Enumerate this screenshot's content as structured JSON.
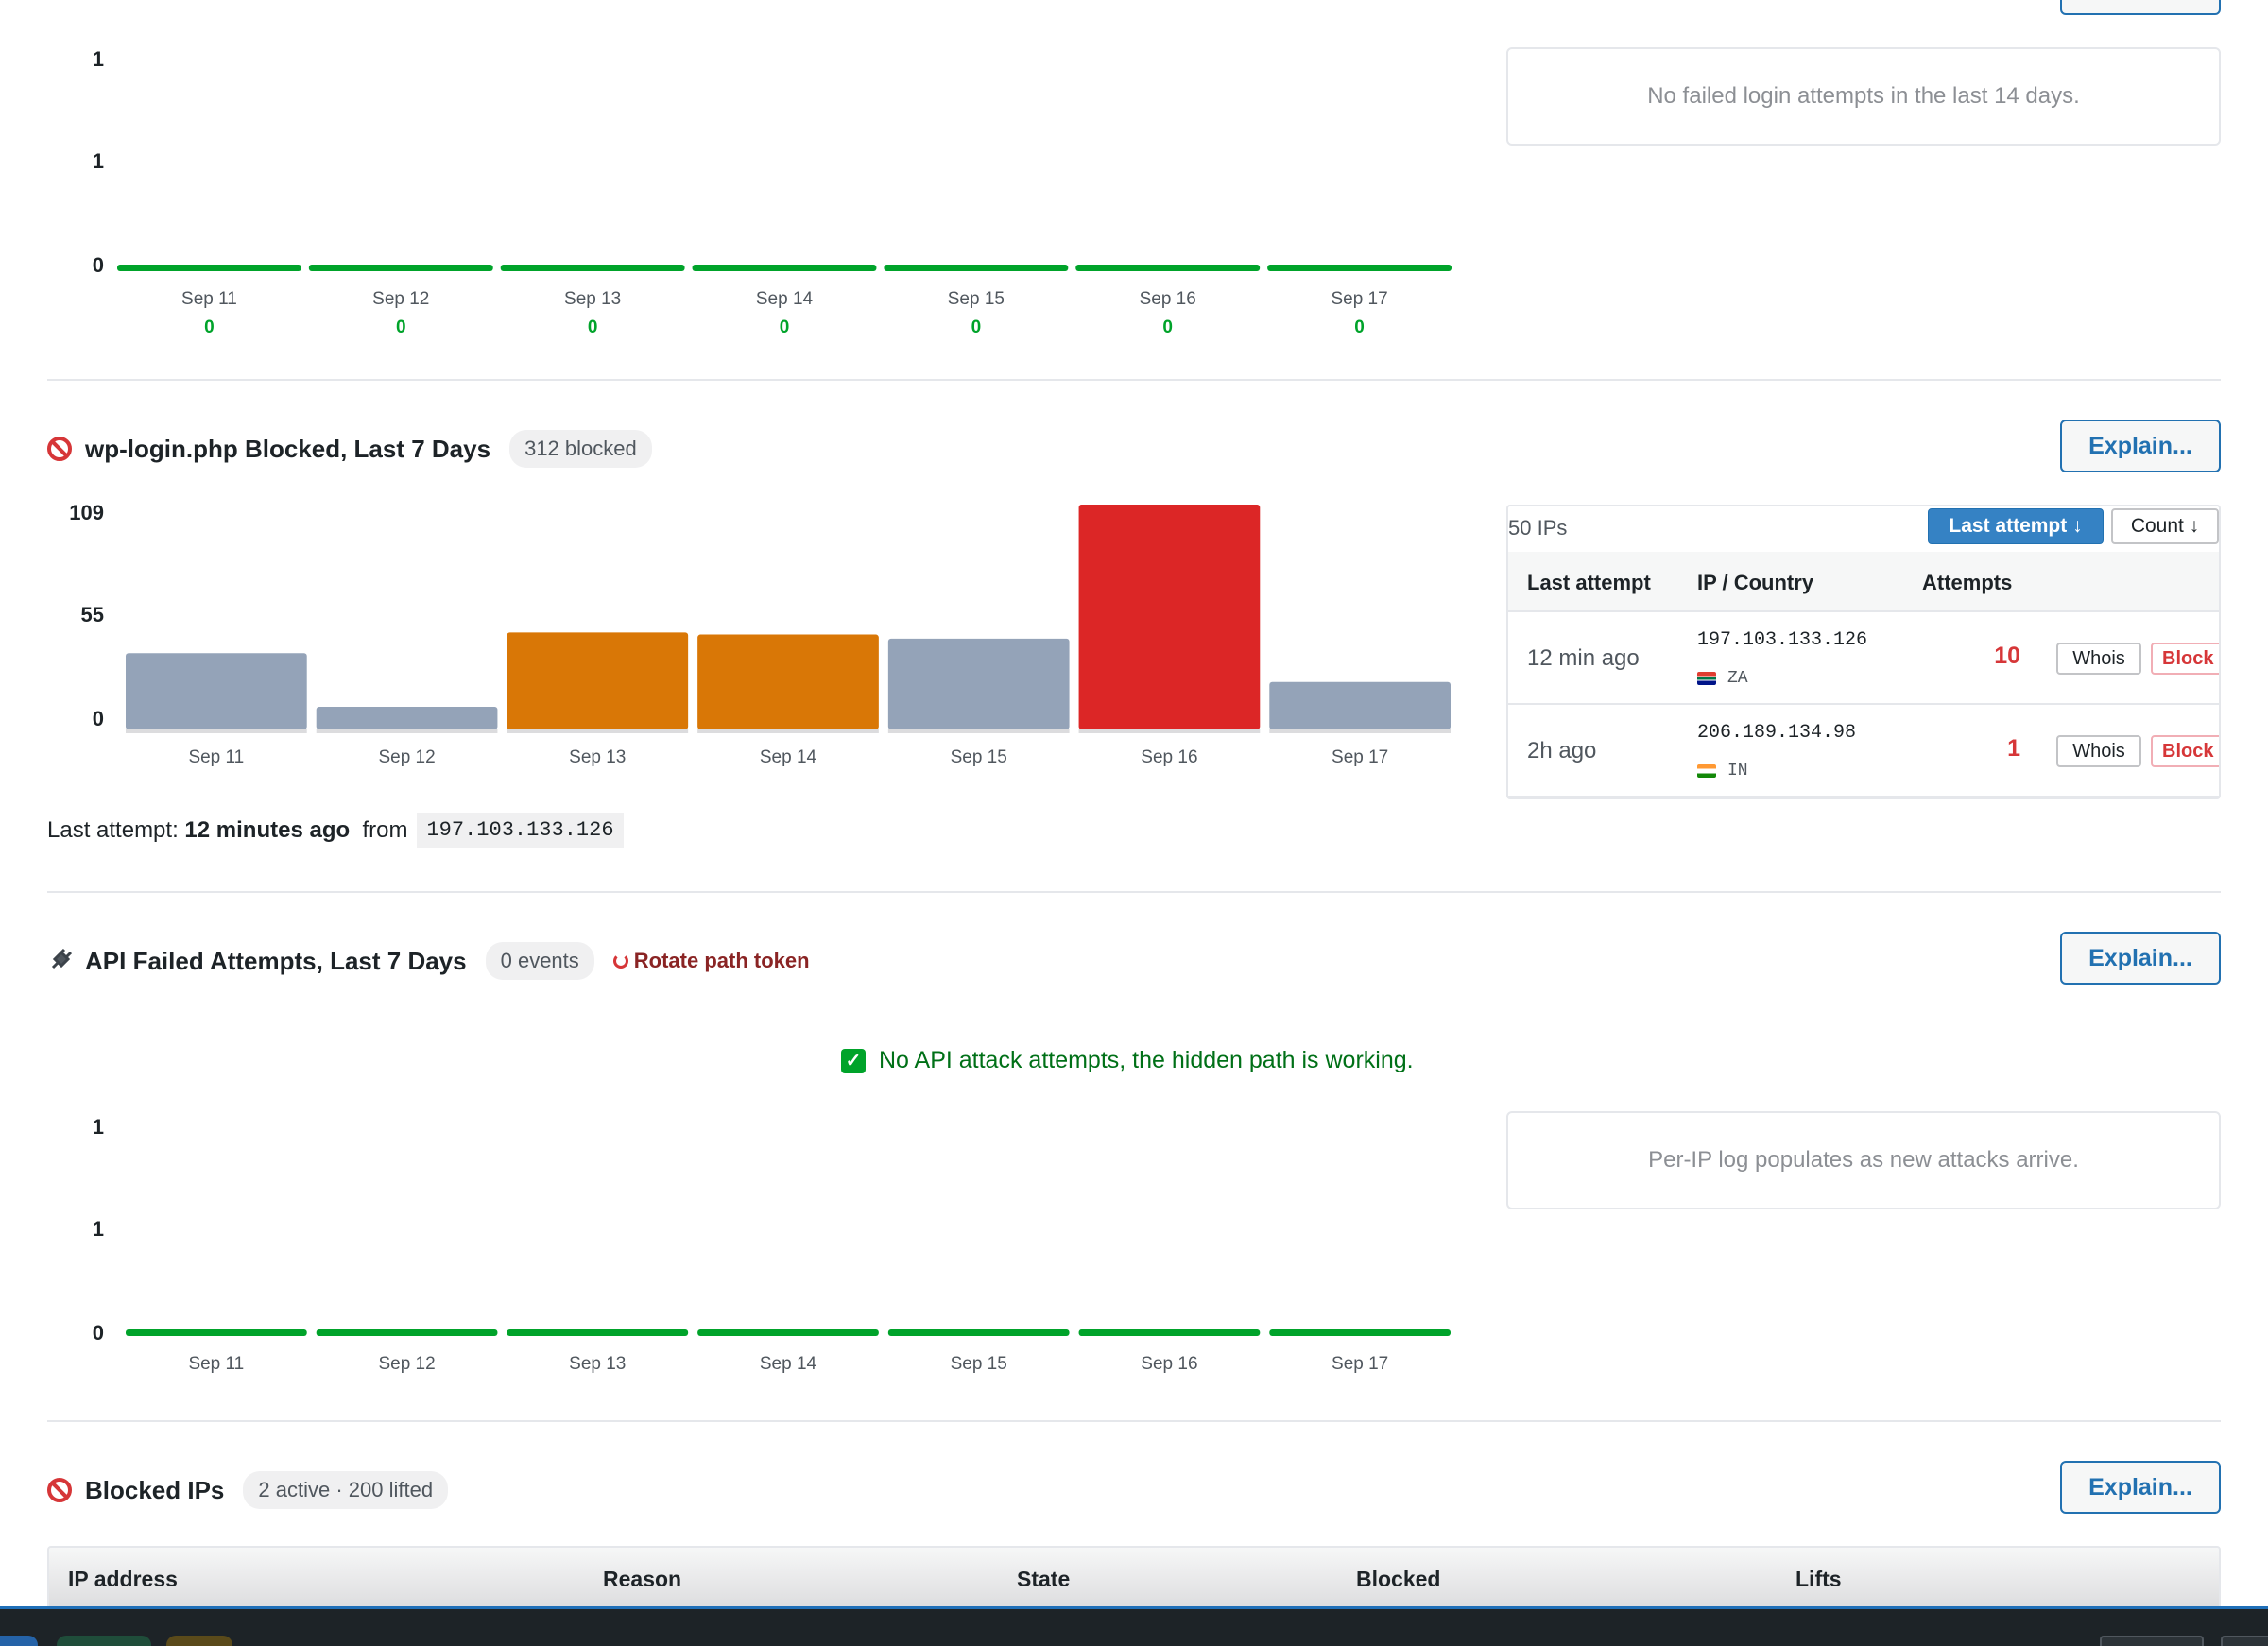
{
  "sections": {
    "failed_logins": {
      "empty_text": "No failed login attempts in the last 14 days.",
      "explain_label": "Explain..."
    },
    "wp_login": {
      "title": "wp-login.php Blocked, Last 7 Days",
      "badge": "312 blocked",
      "explain_label": "Explain...",
      "last_attempt_prefix": "Last attempt:",
      "last_attempt_time": "12 minutes ago",
      "last_attempt_from": "from",
      "last_attempt_ip": "197.103.133.126"
    },
    "api": {
      "title": "API Failed Attempts, Last 7 Days",
      "badge": "0 events",
      "rotate_label": "Rotate path token",
      "explain_label": "Explain...",
      "ok_message": "No API attack attempts, the hidden path is working.",
      "empty_text": "Per-IP log populates as new attacks arrive."
    },
    "blocked_ips": {
      "title": "Blocked IPs",
      "badge": "2 active · 200 lifted",
      "explain_label": "Explain...",
      "columns": [
        "IP address",
        "Reason",
        "State",
        "Blocked",
        "Lifts"
      ]
    }
  },
  "ip_panel": {
    "count_label": "50 IPs",
    "sort_active": "Last attempt ↓",
    "sort_inactive": "Count ↓",
    "headers": [
      "Last attempt",
      "IP / Country",
      "Attempts"
    ],
    "rows": [
      {
        "when": "12 min ago",
        "ip": "197.103.133.126",
        "country": "ZA",
        "attempts": "10",
        "whois": "Whois",
        "block": "Block"
      },
      {
        "when": "2h ago",
        "ip": "206.189.134.98",
        "country": "IN",
        "attempts": "1",
        "whois": "Whois",
        "block": "Block"
      }
    ]
  },
  "colors": {
    "green": "#00a32a",
    "gray": "#94a3b8",
    "orange": "#d97706",
    "red": "#dc2626",
    "accent": "#2271b1"
  },
  "chart_data": [
    {
      "type": "bar",
      "categories": [
        "Sep 11",
        "Sep 12",
        "Sep 13",
        "Sep 14",
        "Sep 15",
        "Sep 16",
        "Sep 17"
      ],
      "values": [
        0,
        0,
        0,
        0,
        0,
        0,
        0
      ],
      "value_labels": [
        "0",
        "0",
        "0",
        "0",
        "0",
        "0",
        "0"
      ],
      "yticks": [
        "1",
        "1",
        "0"
      ],
      "ylim": [
        0,
        1
      ]
    },
    {
      "type": "bar",
      "categories": [
        "Sep 11",
        "Sep 12",
        "Sep 13",
        "Sep 14",
        "Sep 15",
        "Sep 16",
        "Sep 17"
      ],
      "values": [
        37,
        11,
        47,
        46,
        44,
        109,
        23
      ],
      "bar_colors": [
        "gray",
        "gray",
        "orange",
        "orange",
        "gray",
        "red",
        "gray"
      ],
      "yticks": [
        "109",
        "55",
        "0"
      ],
      "ylim": [
        0,
        109
      ]
    },
    {
      "type": "bar",
      "categories": [
        "Sep 11",
        "Sep 12",
        "Sep 13",
        "Sep 14",
        "Sep 15",
        "Sep 16",
        "Sep 17"
      ],
      "values": [
        0,
        0,
        0,
        0,
        0,
        0,
        0
      ],
      "yticks": [
        "1",
        "1",
        "0"
      ],
      "ylim": [
        0,
        1
      ]
    }
  ]
}
